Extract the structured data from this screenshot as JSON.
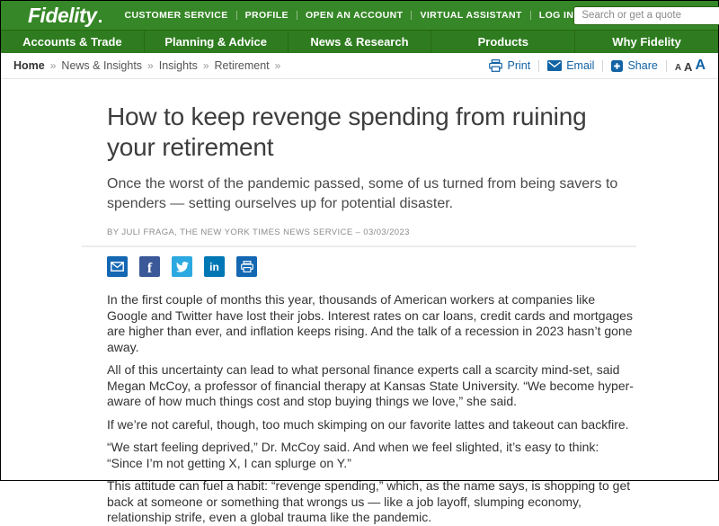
{
  "header": {
    "logo_text": "Fidelity",
    "utility_links": [
      "CUSTOMER SERVICE",
      "PROFILE",
      "OPEN AN ACCOUNT",
      "VIRTUAL ASSISTANT",
      "LOG IN"
    ],
    "search": {
      "placeholder": "Search or get a quote"
    }
  },
  "nav": {
    "items": [
      "Accounts & Trade",
      "Planning & Advice",
      "News & Research",
      "Products",
      "Why Fidelity"
    ]
  },
  "breadcrumb": {
    "separator": "»",
    "items": [
      "Home",
      "News & Insights",
      "Insights",
      "Retirement"
    ]
  },
  "toolbar": {
    "print_label": "Print",
    "email_label": "Email",
    "share_label": "Share",
    "font_sizes": [
      "A",
      "A",
      "A"
    ]
  },
  "article": {
    "title": "How to keep revenge spending from ruining your retirement",
    "subtitle": "Once the worst of the pandemic passed, some of us turned from being savers to spenders — setting ourselves up for potential disaster.",
    "byline": "BY JULI FRAGA, THE NEW YORK TIMES NEWS SERVICE – 03/03/2023",
    "social_icons": {
      "facebook_glyph": "f",
      "linkedin_glyph": "in"
    },
    "paragraphs": [
      "In the first couple of months this year, thousands of American workers at companies like Google and Twitter have lost their jobs. Interest rates on car loans, credit cards and mortgages are higher than ever, and inflation keeps rising. And the talk of a recession in 2023 hasn’t gone away.",
      "All of this uncertainty can lead to what personal finance experts call a scarcity mind-set, said Megan McCoy, a professor of financial therapy at Kansas State University. “We become hyper-aware of how much things cost and stop buying things we love,” she said.",
      "If we’re not careful, though, too much skimping on our favorite lattes and takeout can backfire.",
      "“We start feeling deprived,” Dr. McCoy said. And when we feel slighted, it’s easy to think: “Since I’m not getting X, I can splurge on Y.”",
      "This attitude can fuel a habit: “revenge spending,” which, as the name says, is shopping to get back at someone or something that wrongs us — like a job layoff, slumping economy, relationship strife, even a global trauma like the pandemic."
    ]
  },
  "colors": {
    "brand_green": "#368727",
    "nav_green": "#2e7c1f",
    "search_button_green": "#55a42c",
    "link_blue": "#1163a5",
    "facebook_blue": "#3b5998",
    "twitter_blue": "#2ca9e1",
    "linkedin_blue": "#0077b5"
  }
}
